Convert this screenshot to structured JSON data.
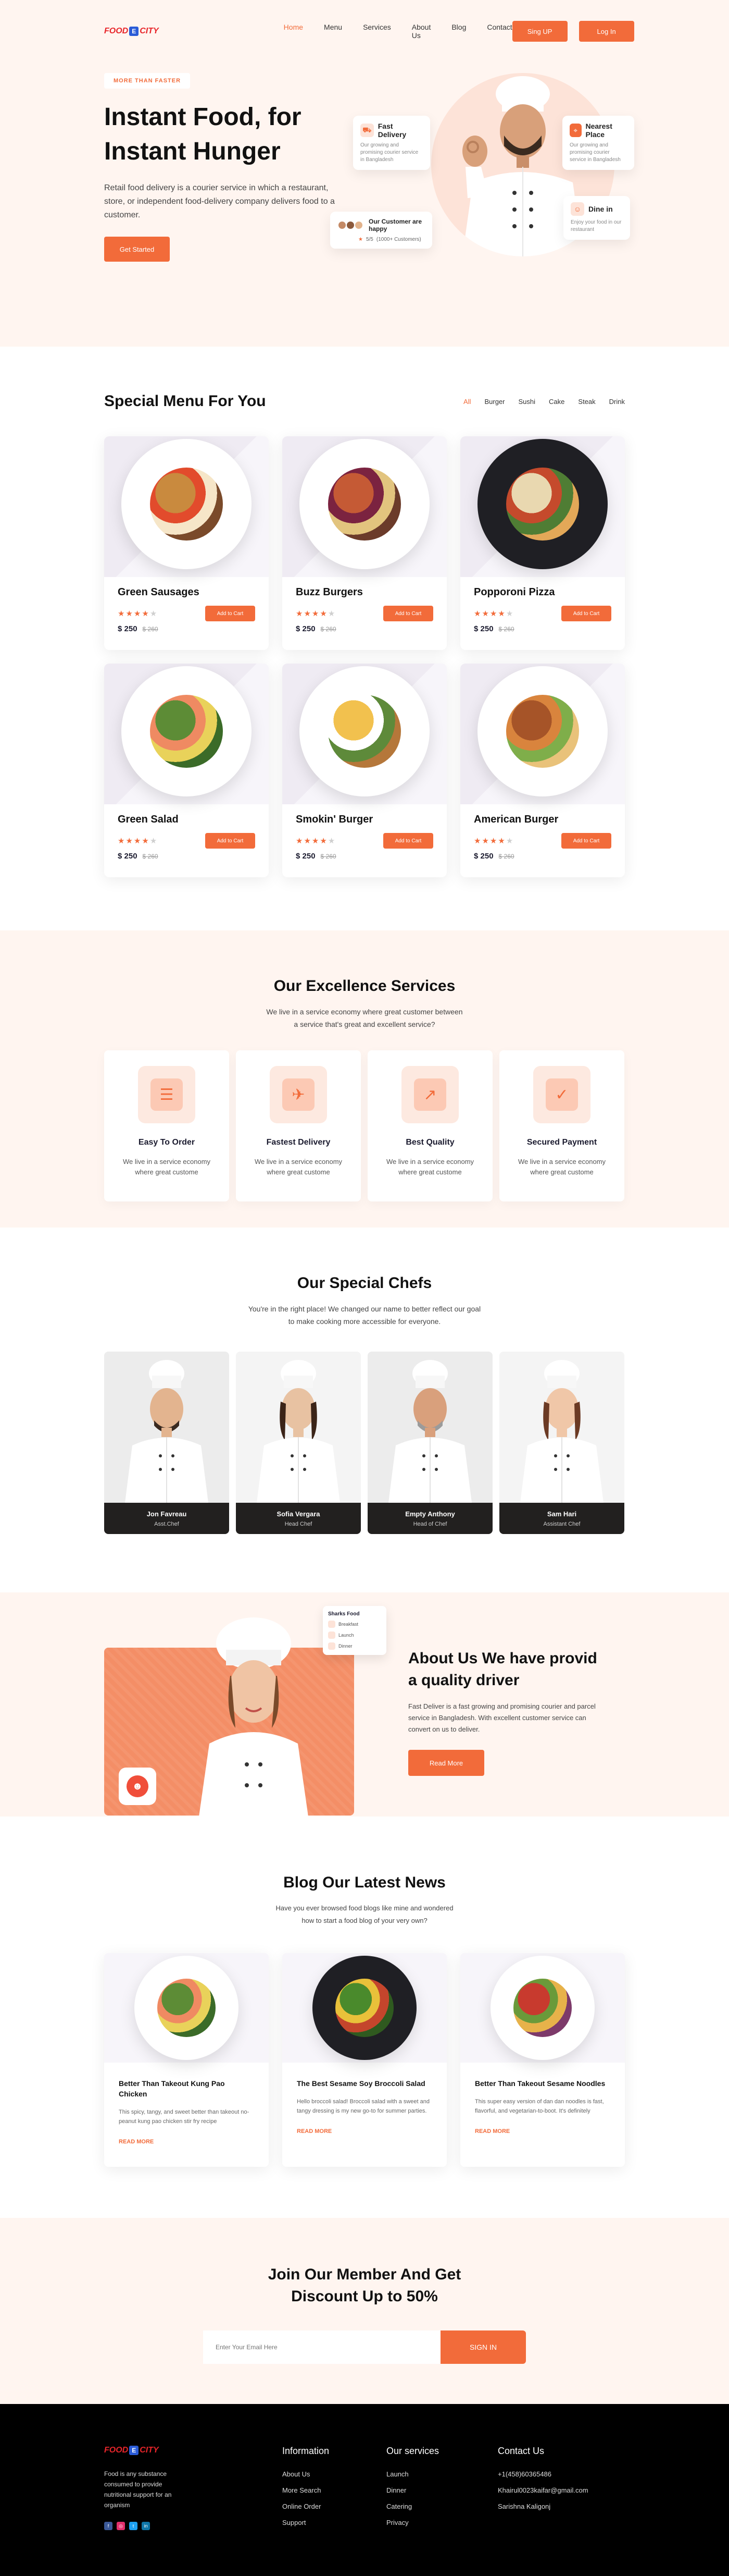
{
  "nav": {
    "logo_left": "FOOD",
    "logo_mark": "E",
    "logo_right": "CITY",
    "links": [
      "Home",
      "Menu",
      "Services",
      "About Us",
      "Blog",
      "Contact"
    ],
    "active_link": "Home",
    "signup_label": "Sing UP",
    "login_label": "Log In"
  },
  "hero": {
    "badge": "MORE THAN FASTER",
    "title": "Instant Food, for Instant Hunger",
    "description": "Retail food delivery is a courier service in which a restaurant, store, or independent food-delivery company delivers food to a customer.",
    "cta_label": "Get Started",
    "cards": {
      "fast_delivery": {
        "title": "Fast Delivery",
        "text": "Our growing and promising courier service in Bangladesh"
      },
      "nearest_place": {
        "title": "Nearest Place",
        "text": "Our growing and promising courier service in Bangladesh"
      },
      "dine_in": {
        "title": "Dine in",
        "text": "Enjoy your food in our restaurant"
      },
      "happy": {
        "title": "Our Customer are happy",
        "rating": "5/5",
        "count": "(1000+ Customers)"
      }
    }
  },
  "menu": {
    "title": "Special Menu For You",
    "filters": [
      "All",
      "Burger",
      "Sushi",
      "Cake",
      "Steak",
      "Drink"
    ],
    "active_filter": "All",
    "items": [
      {
        "name": "Green Sausages",
        "rating": 4,
        "price": "$ 250",
        "old_price": "$ 260",
        "button": "Add to Cart",
        "plate": "light",
        "food_colors": [
          "#c98a3e",
          "#e24b2c",
          "#f6e6c8",
          "#7a4a2a"
        ]
      },
      {
        "name": "Buzz Burgers",
        "rating": 4,
        "price": "$ 250",
        "old_price": "$ 260",
        "button": "Add to Cart",
        "plate": "light",
        "food_colors": [
          "#c55a35",
          "#7b2340",
          "#e2c47e",
          "#6b3b2a"
        ]
      },
      {
        "name": "Popporoni Pizza",
        "rating": 4,
        "price": "$ 250",
        "old_price": "$ 260",
        "button": "Add to Cart",
        "plate": "dark",
        "food_colors": [
          "#e9d8b0",
          "#c54a2c",
          "#4f7d34",
          "#e3a858"
        ]
      },
      {
        "name": "Green Salad",
        "rating": 4,
        "price": "$ 250",
        "old_price": "$ 260",
        "button": "Add to Cart",
        "plate": "light",
        "food_colors": [
          "#5d8c36",
          "#ef8a62",
          "#e9d25a",
          "#3b6b28"
        ]
      },
      {
        "name": "Smokin' Burger",
        "rating": 4,
        "price": "$ 250",
        "old_price": "$ 260",
        "button": "Add to Cart",
        "plate": "light",
        "food_colors": [
          "#f2c14e",
          "#ffffff",
          "#5e8a3a",
          "#b5773a"
        ]
      },
      {
        "name": "American Burger",
        "rating": 4,
        "price": "$ 250",
        "old_price": "$ 260",
        "button": "Add to Cart",
        "plate": "light",
        "food_colors": [
          "#a65428",
          "#d9843d",
          "#7fae4a",
          "#e9c27a"
        ]
      }
    ]
  },
  "services": {
    "title": "Our Excellence Services",
    "subtitle": "We live in a service economy where great customer  between a service that's great and excellent service?",
    "items": [
      {
        "title": "Easy To Order",
        "text": "We live in a service economy where great custome",
        "icon": "order-list-icon",
        "glyph": "☰"
      },
      {
        "title": "Fastest Delivery",
        "text": "We live in a service economy where great custome",
        "icon": "scooter-icon",
        "glyph": "✈"
      },
      {
        "title": "Best Quality",
        "text": "We live in a service economy where great custome",
        "icon": "chart-up-icon",
        "glyph": "↗"
      },
      {
        "title": "Secured Payment",
        "text": "We live in a service economy where great custome",
        "icon": "shield-payment-icon",
        "glyph": "✓"
      }
    ]
  },
  "chefs": {
    "title": "Our Special Chefs",
    "subtitle": "You're in the right place! We changed our name to better reflect our goal to make cooking more accessible for everyone.",
    "items": [
      {
        "name": "Jon Favreau",
        "role": "Asst.Chef",
        "skin": "#e3b48f",
        "hair": "#3a2a20",
        "gender": "m"
      },
      {
        "name": "Sofia Vergara",
        "role": "Head Chef",
        "skin": "#e8c2a2",
        "hair": "#3b2418",
        "gender": "f"
      },
      {
        "name": "Empty Anthony",
        "role": "Head of Chef",
        "skin": "#d9a07c",
        "hair": "#9b9b9b",
        "gender": "m"
      },
      {
        "name": "Sam Hari",
        "role": "Assistant Chef",
        "skin": "#f0c7a8",
        "hair": "#6b3a24",
        "gender": "f"
      }
    ]
  },
  "about": {
    "title": "About Us We have provid a quality driver",
    "description": "Fast Deliver is a fast growing and promising courier and parcel service in Bangladesh. With excellent customer service can convert on us to deliver.",
    "cta_label": "Read More",
    "mini_card": {
      "title": "Sharks Food",
      "rows": [
        "Breakfast",
        "Launch",
        "Dinner"
      ]
    }
  },
  "blog": {
    "title": "Blog Our Latest News",
    "subtitle": "Have you ever browsed food blogs like mine and wondered how to start a food blog of your very own?",
    "items": [
      {
        "title": "Better Than Takeout Kung Pao Chicken",
        "text": "This spicy, tangy, and sweet better than takeout no-peanut kung pao chicken stir fry recipe",
        "more": "READ MORE",
        "plate": "light",
        "food_colors": [
          "#5d8c36",
          "#ef8a62",
          "#e9d25a",
          "#3b6b28"
        ]
      },
      {
        "title": "The Best Sesame Soy Broccoli Salad",
        "text": "Hello broccoli salad! Broccoli salad with a sweet and tangy dressing is my new go-to for summer parties.",
        "more": "READ MORE",
        "plate": "dark",
        "food_colors": [
          "#4a8a2c",
          "#e9c13a",
          "#c4452c",
          "#2f5a1f"
        ]
      },
      {
        "title": "Better Than Takeout Sesame Noodles",
        "text": "This super easy version of dan dan noodles is fast, flavorful, and vegetarian-to-boot. It's definitely",
        "more": "READ MORE",
        "plate": "light",
        "food_colors": [
          "#c83a2e",
          "#6a9a3a",
          "#e7b24a",
          "#7d3a6a"
        ]
      }
    ]
  },
  "join": {
    "title_line1": "Join Our  Member And Get",
    "title_line2": "Discount Up to 50%",
    "placeholder": "Enter Your Email Here",
    "button": "SIGN IN"
  },
  "footer": {
    "about": "Food is any substance consumed to provide nutritional support for an organism",
    "information": {
      "heading": "Information",
      "links": [
        "About Us",
        "More Search",
        "Online Order",
        "Support"
      ]
    },
    "services": {
      "heading": "Our services",
      "links": [
        "Launch",
        "Dinner",
        "Catering",
        "Privacy"
      ]
    },
    "contact": {
      "heading": "Contact Us",
      "items": [
        "+1(458)60365486",
        "Khairul0023kaifar@gmail.com",
        "Sarishna Kaligonj"
      ]
    },
    "social_colors": [
      "#3b5998",
      "#e1306c",
      "#1da1f2",
      "#0e76a8"
    ]
  },
  "colors": {
    "accent": "#f26b3a",
    "hero_bg": "#fff5f0",
    "footer_bg": "#000000"
  }
}
